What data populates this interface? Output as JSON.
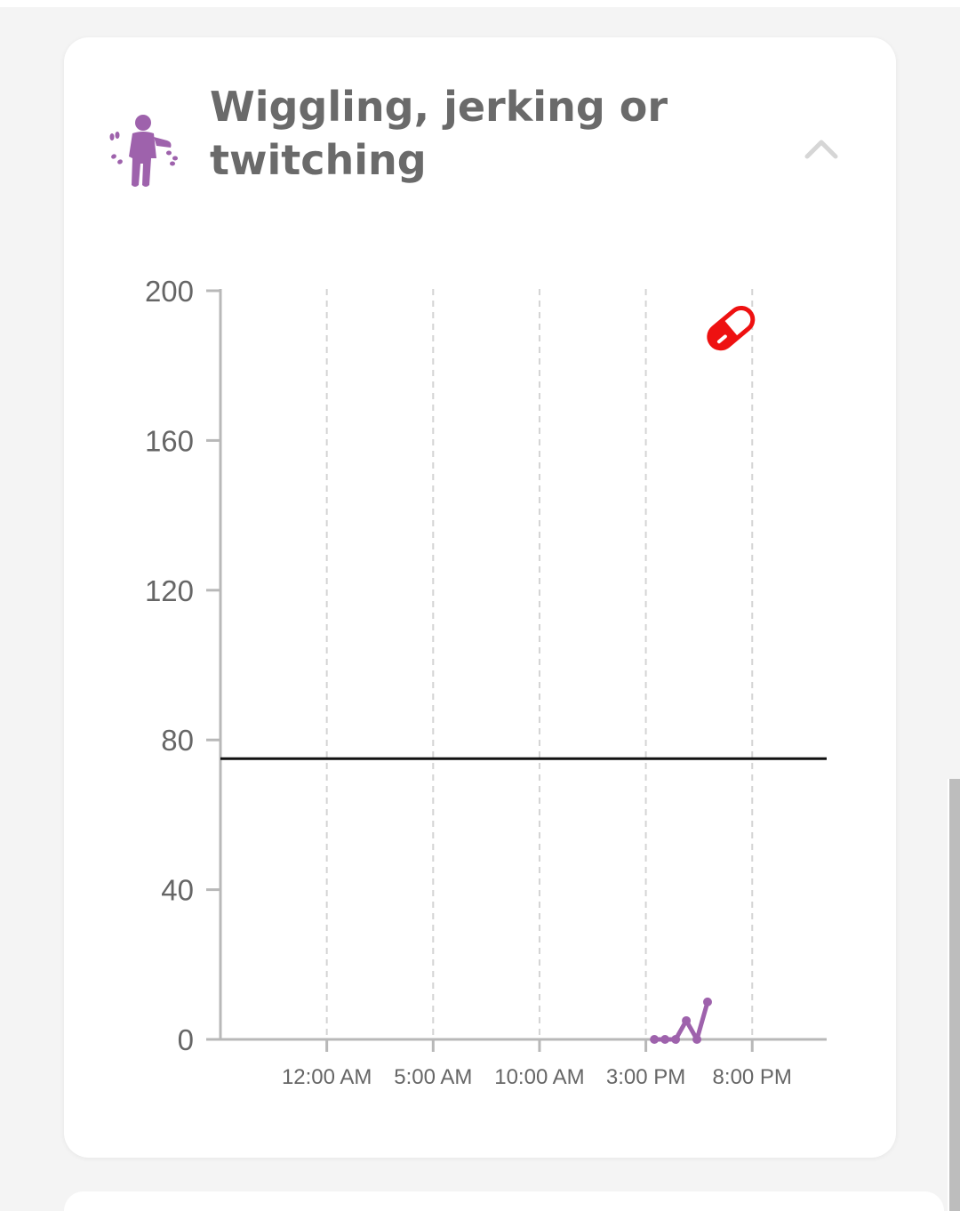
{
  "card": {
    "title": "Wiggling, jerking or twitching",
    "icon": "twitching-person-icon",
    "collapse_icon": "chevron-up-icon",
    "accent_color": "#9e62ac"
  },
  "chart_data": {
    "type": "line",
    "x_tick_labels": [
      "12:00 AM",
      "5:00 AM",
      "10:00 AM",
      "3:00 PM",
      "8:00 PM"
    ],
    "x_ticks_hours": [
      0,
      5,
      10,
      15,
      20
    ],
    "xlim_hours": [
      -5,
      23.5
    ],
    "ylim": [
      0,
      200
    ],
    "y_ticks": [
      0,
      40,
      80,
      120,
      160,
      200
    ],
    "y_tick_labels": [
      "0",
      "40",
      "80",
      "120",
      "160",
      "200"
    ],
    "grid": "vertical dashed",
    "series": [
      {
        "color": "#9e62ac",
        "points": [
          {
            "x": 15.4,
            "y": 0
          },
          {
            "x": 15.9,
            "y": 0
          },
          {
            "x": 16.4,
            "y": 0
          },
          {
            "x": 16.9,
            "y": 5
          },
          {
            "x": 17.4,
            "y": 0
          },
          {
            "x": 17.9,
            "y": 10
          }
        ]
      }
    ],
    "reference_line": {
      "y": 75,
      "color": "#111111"
    },
    "markers": [
      {
        "icon": "medication-pill-icon",
        "x": 19.0,
        "y": 190,
        "color": "#ee1111"
      }
    ]
  }
}
